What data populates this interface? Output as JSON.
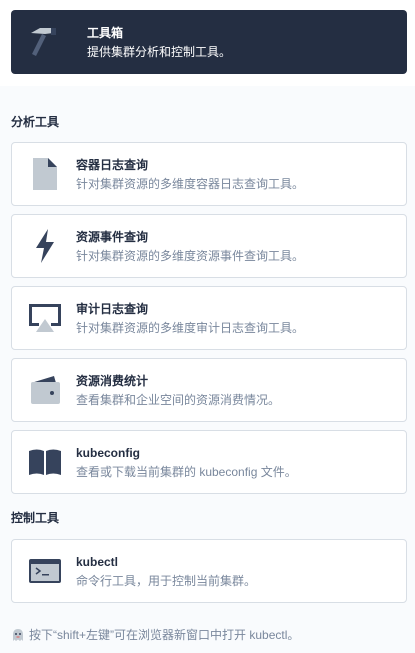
{
  "header": {
    "title": "工具箱",
    "description": "提供集群分析和控制工具。",
    "icon": "hammer-icon"
  },
  "sections": {
    "analysis": {
      "title": "分析工具",
      "items": [
        {
          "title": "容器日志查询",
          "description": "针对集群资源的多维度容器日志查询工具。",
          "icon": "document-icon"
        },
        {
          "title": "资源事件查询",
          "description": "针对集群资源的多维度资源事件查询工具。",
          "icon": "lightning-icon"
        },
        {
          "title": "审计日志查询",
          "description": "针对集群资源的多维度审计日志查询工具。",
          "icon": "monitor-icon"
        },
        {
          "title": "资源消费统计",
          "description": "查看集群和企业空间的资源消费情况。",
          "icon": "wallet-icon"
        },
        {
          "title": "kubeconfig",
          "description": "查看或下载当前集群的 kubeconfig 文件。",
          "icon": "book-icon"
        }
      ]
    },
    "control": {
      "title": "控制工具",
      "items": [
        {
          "title": "kubectl",
          "description": "命令行工具，用于控制当前集群。",
          "icon": "terminal-icon"
        }
      ]
    }
  },
  "footer": {
    "tip": "按下“shift+左键”可在浏览器新窗口中打开 kubectl。",
    "icon": "ghost-icon"
  },
  "colors": {
    "header_bg": "#242e42",
    "icon_dark": "#36435c",
    "icon_light": "#c1c9d1",
    "text_secondary": "#79879c",
    "border": "#d8dee5"
  }
}
